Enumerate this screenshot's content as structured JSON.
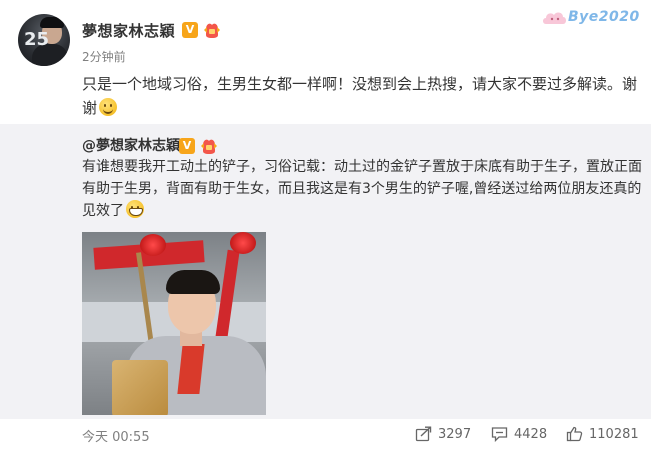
{
  "post": {
    "username": "夢想家林志穎",
    "verified_badge": "V",
    "time": "2分钟前",
    "text": "只是一个地域习俗，生男生女都一样啊！没想到会上热搜，请大家不要过多解读。谢谢"
  },
  "watermark": "Bye2020",
  "repost": {
    "username": "@夢想家林志穎",
    "verified_badge": "V",
    "text": "有谁想要我开工动土的铲子，习俗记载：动土过的金铲子置放于床底有助于生子，置放正面有助于生男，背面有助于生女，而且我这是有3个男生的铲子喔,曾经送过给两位朋友还真的见效了"
  },
  "footer": {
    "time": "今天 00:55",
    "repost_count": "3297",
    "comment_count": "4428",
    "like_count": "110281"
  },
  "icons": {
    "avatar": "avatar-photo",
    "verified": "verified-v-icon",
    "fan": "fan-badge-icon",
    "share": "share-icon",
    "comment": "comment-icon",
    "like": "thumbs-up-icon"
  },
  "colors": {
    "verified_badge": "#f7a51a",
    "repost_background": "#f2f2f5",
    "meta_text": "#808080"
  }
}
